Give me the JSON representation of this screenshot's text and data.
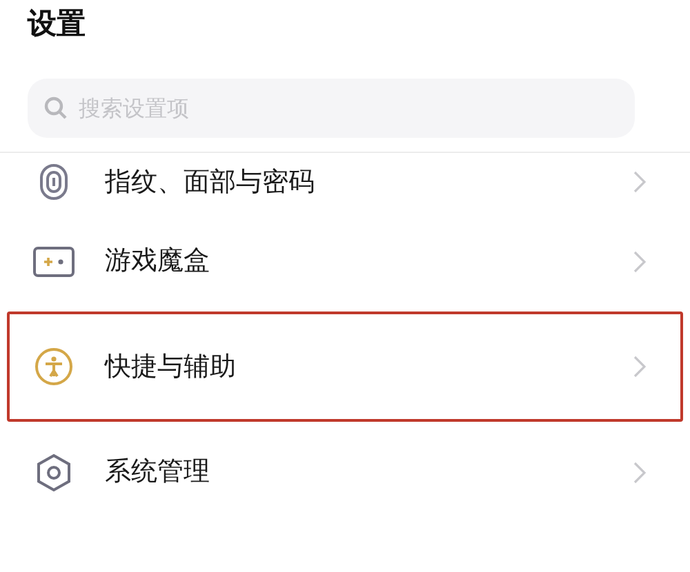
{
  "header": {
    "title": "设置"
  },
  "search": {
    "placeholder": "搜索设置项"
  },
  "items": [
    {
      "kind": "fingerprint",
      "label": "指纹、面部与密码",
      "highlighted": false
    },
    {
      "kind": "game",
      "label": "游戏魔盒",
      "highlighted": false
    },
    {
      "kind": "accessibility",
      "label": "快捷与辅助",
      "highlighted": true
    },
    {
      "kind": "system",
      "label": "系统管理",
      "highlighted": false
    }
  ]
}
